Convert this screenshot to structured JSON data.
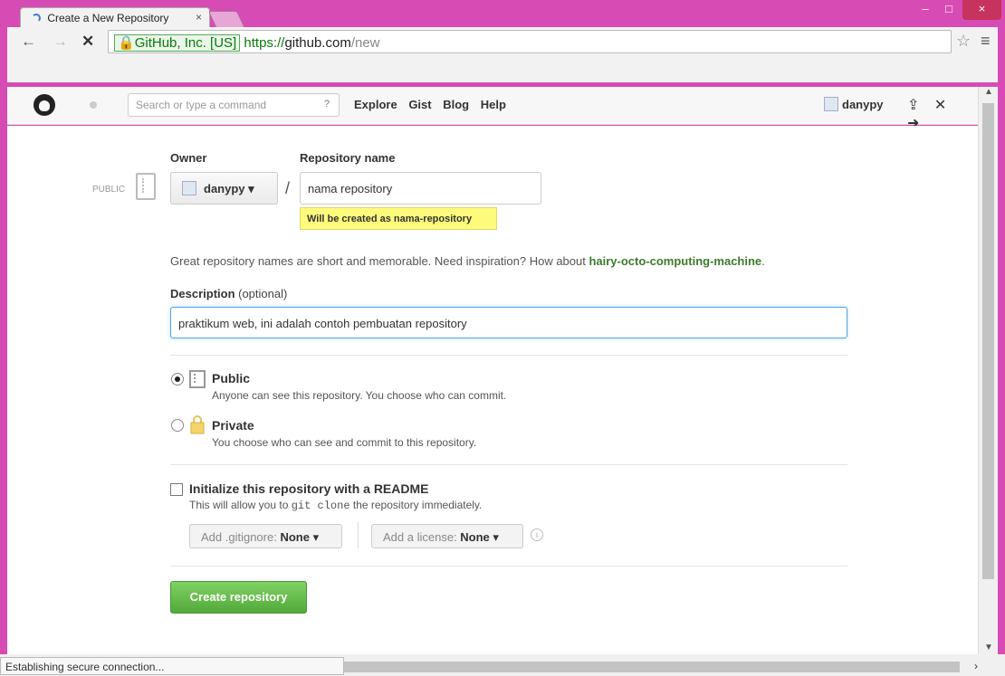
{
  "browser": {
    "tab_title": "Create a New Repository",
    "tab_close": "×",
    "window_controls": {
      "minimize": "–",
      "maximize": "□",
      "close": "×"
    },
    "nav": {
      "back": "←",
      "forward": "→",
      "stop": "✕"
    },
    "security_label": "GitHub, Inc. [US]",
    "url_scheme": "https://",
    "url_host": "github.com",
    "url_path": "/new",
    "star": "☆",
    "menu": "≡",
    "status": "Establishing secure connection...",
    "scroll_up": "▲",
    "scroll_down": "▼",
    "scroll_right": "›"
  },
  "github_header": {
    "search_placeholder": "Search or type a command",
    "search_help": "?",
    "nav": [
      "Explore",
      "Gist",
      "Blog",
      "Help"
    ],
    "username": "danypy",
    "user_icons": "⇪ ✕ ➜"
  },
  "form": {
    "owner_label": "Owner",
    "repo_label": "Repository name",
    "visibility_badge": "PUBLIC",
    "owner_value": "danypy",
    "owner_caret": "▾",
    "slash": "/",
    "repo_value": "nama repository",
    "repo_hint": "Will be created as nama-repository",
    "inspiration_text": "Great repository names are short and memorable. Need inspiration? How about ",
    "inspiration_suggestion": "hairy-octo-computing-machine",
    "inspiration_end": ".",
    "description_label": "Description",
    "description_optional": " (optional)",
    "description_value": "praktikum web, ini adalah contoh pembuatan repository",
    "visibility_options": [
      {
        "title": "Public",
        "desc": "Anyone can see this repository. You choose who can commit.",
        "selected": true
      },
      {
        "title": "Private",
        "desc": "You choose who can see and commit to this repository.",
        "selected": false
      }
    ],
    "init_title": "Initialize this repository with a README",
    "init_desc_before": "This will allow you to ",
    "init_desc_code": "git clone",
    "init_desc_after": " the repository immediately.",
    "gitignore_label": "Add .gitignore: ",
    "gitignore_value": "None",
    "license_label": "Add a license: ",
    "license_value": "None",
    "dropdown_caret": "▾",
    "info_icon": "i",
    "create_button": "Create repository"
  },
  "colors": {
    "window_frame": "#d64cb4",
    "link_green": "#3f7a2b",
    "button_green": "#53a93b",
    "hint_yellow": "#fefb7c",
    "focus_blue": "#51a7e8"
  }
}
